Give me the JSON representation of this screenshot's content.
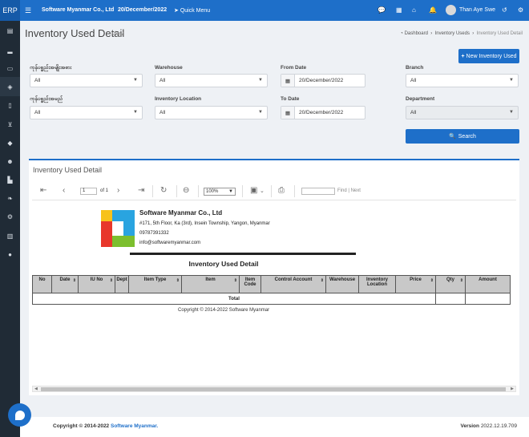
{
  "topbar": {
    "brand": "ERP",
    "company": "Software Myanmar Co., Ltd",
    "date": "20/December/2022",
    "quick_menu": "Quick Menu",
    "user": "Than Aye Swe",
    "icons": [
      "chat-icon",
      "building-icon",
      "home-icon",
      "bell-icon",
      "history-icon",
      "gear-icon"
    ]
  },
  "sidebar": {
    "icons": [
      "calculator-icon",
      "chart-icon",
      "card-icon",
      "box-icon",
      "clipboard-icon",
      "cart-icon",
      "diamond-icon",
      "users-icon",
      "factory-icon",
      "leaf-icon",
      "gear-icon",
      "book-icon",
      "comment-icon"
    ],
    "active_index": 3
  },
  "header": {
    "title": "Inventory Used Detail",
    "subtitle": "View",
    "breadcrumb": [
      "Dashboard",
      "Inventory Useds",
      "Inventory Used Detail"
    ]
  },
  "actions": {
    "new_label": "New Inventory Used",
    "search_label": "Search"
  },
  "filters": {
    "item_category": {
      "label": "ကုန်ပစ္စည်းအမျိုးအစား",
      "value": "All"
    },
    "warehouse": {
      "label": "Warehouse",
      "value": "All"
    },
    "from_date": {
      "label": "From Date",
      "value": "20/December/2022"
    },
    "branch": {
      "label": "Branch",
      "value": "All"
    },
    "item_name": {
      "label": "ကုန်ပစ္စည်းအမည်",
      "value": "All"
    },
    "inventory_location": {
      "label": "Inventory Location",
      "value": "All"
    },
    "to_date": {
      "label": "To Date",
      "value": "20/December/2022"
    },
    "department": {
      "label": "Department",
      "value": "All"
    }
  },
  "report": {
    "panel_title": "Inventory Used Detail",
    "page_current": "1",
    "page_of": "of 1",
    "zoom": "100%",
    "find_label": "Find",
    "next_label": "Next",
    "company": "Software Myanmar Co., Ltd",
    "address": "#171, 5th Floor, Ka (3rd), Insein Township, Yangon, Myanmar",
    "phone": "09787391332",
    "email": "info@softwaremyanmar.com",
    "title": "Inventory Used Detail",
    "columns": [
      "No",
      "Date",
      "IU No",
      "Dept",
      "Item Type",
      "Item",
      "Item Code",
      "Control Account",
      "Warehouse",
      "Inventory Location",
      "Price",
      "Qty",
      "Amount"
    ],
    "total_label": "Total",
    "copyright": "Copyright © 2014-2022 Software Myanmar"
  },
  "footer": {
    "copyright_prefix": "Copyright © 2014-2022",
    "copyright_link": "Software Myanmar.",
    "version_label": "Version",
    "version": "2022.12.19.709"
  }
}
